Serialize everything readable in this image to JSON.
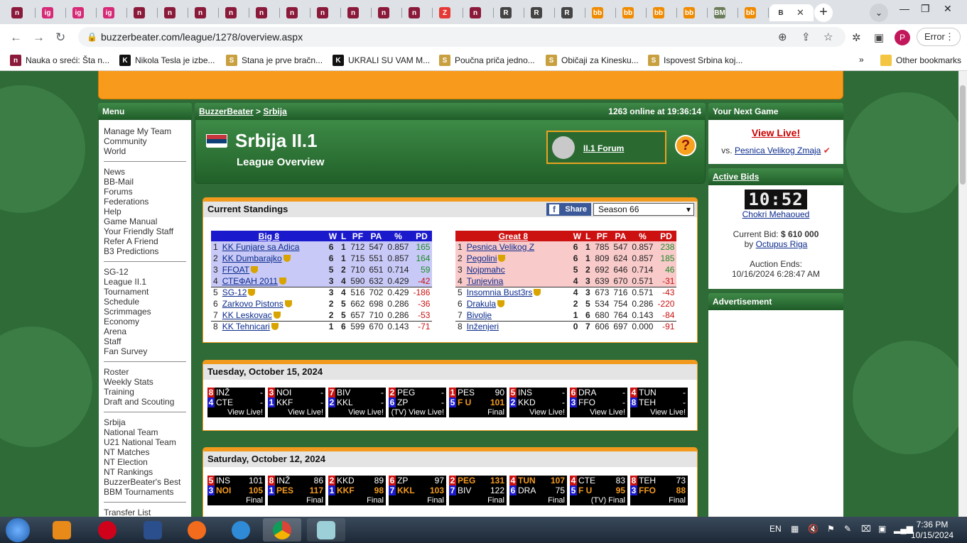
{
  "browser": {
    "url": "buzzerbeater.com/league/1278/overview.aspx",
    "active_tab_label": "B",
    "error_button": "Error",
    "profile_initial": "P",
    "tabs": [
      {
        "label": "n",
        "color": "#8b1a3a"
      },
      {
        "label": "ig",
        "color": "#d62976"
      },
      {
        "label": "ig",
        "color": "#d62976"
      },
      {
        "label": "ig",
        "color": "#d62976"
      },
      {
        "label": "n",
        "color": "#8b1a3a"
      },
      {
        "label": "n",
        "color": "#8b1a3a"
      },
      {
        "label": "n",
        "color": "#8b1a3a"
      },
      {
        "label": "n",
        "color": "#8b1a3a"
      },
      {
        "label": "n",
        "color": "#8b1a3a"
      },
      {
        "label": "n",
        "color": "#8b1a3a"
      },
      {
        "label": "n",
        "color": "#8b1a3a"
      },
      {
        "label": "n",
        "color": "#8b1a3a"
      },
      {
        "label": "n",
        "color": "#8b1a3a"
      },
      {
        "label": "n",
        "color": "#8b1a3a"
      },
      {
        "label": "Z",
        "color": "#e53935"
      },
      {
        "label": "n",
        "color": "#8b1a3a"
      },
      {
        "label": "R",
        "color": "#444444"
      },
      {
        "label": "R",
        "color": "#444444"
      },
      {
        "label": "R",
        "color": "#444444"
      },
      {
        "label": "bb",
        "color": "#f08a00"
      },
      {
        "label": "bb",
        "color": "#f08a00"
      },
      {
        "label": "bb",
        "color": "#f08a00"
      },
      {
        "label": "bb",
        "color": "#f08a00"
      },
      {
        "label": "BM",
        "color": "#6b7d5a"
      },
      {
        "label": "bb",
        "color": "#f08a00"
      }
    ],
    "bookmarks": [
      {
        "icon": "n",
        "color": "#8b1a3a",
        "label": "Nauka o sreći: Šta n..."
      },
      {
        "icon": "K",
        "color": "#111111",
        "label": "Nikola Tesla je izbe..."
      },
      {
        "icon": "S",
        "color": "#c8a040",
        "label": "Stana je prve bračn..."
      },
      {
        "icon": "K",
        "color": "#111111",
        "label": "UKRALI SU VAM M..."
      },
      {
        "icon": "S",
        "color": "#c8a040",
        "label": "Poučna priča jedno..."
      },
      {
        "icon": "S",
        "color": "#c8a040",
        "label": "Običaji za Kinesku..."
      },
      {
        "icon": "S",
        "color": "#c8a040",
        "label": "Ispovest Srbina koj..."
      }
    ],
    "bookmarks_more": "»",
    "other_bookmarks": "Other bookmarks"
  },
  "menu": {
    "title": "Menu",
    "groups": [
      [
        "Manage My Team",
        "Community",
        "World"
      ],
      [
        "News",
        "BB-Mail",
        "Forums",
        "Federations",
        "Help",
        "Game Manual",
        "Your Friendly Staff",
        "Refer A Friend",
        "B3 Predictions"
      ],
      [
        "SG-12",
        "League II.1",
        "Tournament",
        "Schedule",
        "Scrimmages",
        "Economy",
        "Arena",
        "Staff",
        "Fan Survey"
      ],
      [
        "Roster",
        "Weekly Stats",
        "Training",
        "Draft and Scouting"
      ],
      [
        "Srbija",
        "National Team",
        "U21 National Team",
        "NT Matches",
        "NT Election",
        "NT Rankings",
        "BuzzerBeater's Best",
        "BBM Tournaments"
      ],
      [
        "Transfer List"
      ]
    ]
  },
  "breadcrumb": {
    "home": "BuzzerBeater",
    "sep": ">",
    "country": "Srbija",
    "online": "1263 online at 19:36:14"
  },
  "league": {
    "title": "Srbija II.1",
    "subtitle": "League Overview",
    "forum": "II.1 Forum",
    "help": "?"
  },
  "standings": {
    "title": "Current Standings",
    "share": "Share",
    "share_icon": "f",
    "season": "Season 66",
    "headers": [
      "W",
      "L",
      "PF",
      "PA",
      "%",
      "PD"
    ],
    "conferences": [
      {
        "name": "Big 8",
        "color": "#1a1acc",
        "rows": [
          {
            "rank": "1",
            "team": "KK Funjare sa Adica",
            "trophy": false,
            "w": "6",
            "l": "1",
            "pf": "712",
            "pa": "547",
            "pct": "0.857",
            "pd": "165"
          },
          {
            "rank": "2",
            "team": "KK Dumbarajko",
            "trophy": true,
            "w": "6",
            "l": "1",
            "pf": "715",
            "pa": "551",
            "pct": "0.857",
            "pd": "164"
          },
          {
            "rank": "3",
            "team": "FFOAT",
            "trophy": true,
            "w": "5",
            "l": "2",
            "pf": "710",
            "pa": "651",
            "pct": "0.714",
            "pd": "59"
          },
          {
            "rank": "4",
            "team": "СТЕФАН 2011",
            "trophy": true,
            "w": "3",
            "l": "4",
            "pf": "590",
            "pa": "632",
            "pct": "0.429",
            "pd": "-42"
          },
          {
            "rank": "5",
            "team": "SG-12",
            "trophy": true,
            "w": "3",
            "l": "4",
            "pf": "516",
            "pa": "702",
            "pct": "0.429",
            "pd": "-186"
          },
          {
            "rank": "6",
            "team": "Zarkovo Pistons",
            "trophy": true,
            "w": "2",
            "l": "5",
            "pf": "662",
            "pa": "698",
            "pct": "0.286",
            "pd": "-36"
          },
          {
            "rank": "7",
            "team": "KK Leskovac",
            "trophy": true,
            "w": "2",
            "l": "5",
            "pf": "657",
            "pa": "710",
            "pct": "0.286",
            "pd": "-53"
          },
          {
            "rank": "8",
            "team": "KK Tehnicari",
            "trophy": true,
            "w": "1",
            "l": "6",
            "pf": "599",
            "pa": "670",
            "pct": "0.143",
            "pd": "-71"
          }
        ]
      },
      {
        "name": "Great 8",
        "color": "#cc1111",
        "rows": [
          {
            "rank": "1",
            "team": "Pesnica Velikog Z",
            "trophy": false,
            "w": "6",
            "l": "1",
            "pf": "785",
            "pa": "547",
            "pct": "0.857",
            "pd": "238"
          },
          {
            "rank": "2",
            "team": "Pegolini",
            "trophy": true,
            "w": "6",
            "l": "1",
            "pf": "809",
            "pa": "624",
            "pct": "0.857",
            "pd": "185"
          },
          {
            "rank": "3",
            "team": "Nojpmahc",
            "trophy": false,
            "w": "5",
            "l": "2",
            "pf": "692",
            "pa": "646",
            "pct": "0.714",
            "pd": "46"
          },
          {
            "rank": "4",
            "team": "Tunjevina",
            "trophy": false,
            "w": "4",
            "l": "3",
            "pf": "639",
            "pa": "670",
            "pct": "0.571",
            "pd": "-31"
          },
          {
            "rank": "5",
            "team": "Insomnia Bust3rs",
            "trophy": true,
            "w": "4",
            "l": "3",
            "pf": "673",
            "pa": "716",
            "pct": "0.571",
            "pd": "-43"
          },
          {
            "rank": "6",
            "team": "Drakula",
            "trophy": true,
            "w": "2",
            "l": "5",
            "pf": "534",
            "pa": "754",
            "pct": "0.286",
            "pd": "-220"
          },
          {
            "rank": "7",
            "team": "Bivolje",
            "trophy": false,
            "w": "1",
            "l": "6",
            "pf": "680",
            "pa": "764",
            "pct": "0.143",
            "pd": "-84"
          },
          {
            "rank": "8",
            "team": "Inženjeri",
            "trophy": false,
            "w": "0",
            "l": "7",
            "pf": "606",
            "pa": "697",
            "pct": "0.000",
            "pd": "-91"
          }
        ]
      }
    ]
  },
  "days": [
    {
      "date": "Tuesday, October 15, 2024",
      "games": [
        {
          "a_seed": "8",
          "a": "INŽ",
          "a_s": "-",
          "b_seed": "4",
          "b": "CTE",
          "b_s": "-",
          "status": "View Live!",
          "win": ""
        },
        {
          "a_seed": "3",
          "a": "NOI",
          "a_s": "-",
          "b_seed": "1",
          "b": "KKF",
          "b_s": "-",
          "status": "View Live!",
          "win": ""
        },
        {
          "a_seed": "7",
          "a": "BIV",
          "a_s": "-",
          "b_seed": "2",
          "b": "KKL",
          "b_s": "-",
          "status": "View Live!",
          "win": ""
        },
        {
          "a_seed": "2",
          "a": "PEG",
          "a_s": "-",
          "b_seed": "6",
          "b": "ZP",
          "b_s": "-",
          "status": "(TV) View Live!",
          "win": ""
        },
        {
          "a_seed": "1",
          "a": "PES",
          "a_s": "90",
          "b_seed": "5",
          "b": "F U",
          "b_s": "101",
          "status": "Final",
          "win": "b"
        },
        {
          "a_seed": "5",
          "a": "INS",
          "a_s": "-",
          "b_seed": "2",
          "b": "KKD",
          "b_s": "-",
          "status": "View Live!",
          "win": ""
        },
        {
          "a_seed": "6",
          "a": "DRA",
          "a_s": "-",
          "b_seed": "3",
          "b": "FFO",
          "b_s": "-",
          "status": "View Live!",
          "win": ""
        },
        {
          "a_seed": "4",
          "a": "TUN",
          "a_s": "-",
          "b_seed": "8",
          "b": "TEH",
          "b_s": "-",
          "status": "View Live!",
          "win": ""
        }
      ]
    },
    {
      "date": "Saturday, October 12, 2024",
      "games": [
        {
          "a_seed": "5",
          "a": "INS",
          "a_s": "101",
          "b_seed": "3",
          "b": "NOI",
          "b_s": "105",
          "status": "Final",
          "win": "b"
        },
        {
          "a_seed": "8",
          "a": "INŽ",
          "a_s": "86",
          "b_seed": "1",
          "b": "PES",
          "b_s": "117",
          "status": "Final",
          "win": "b"
        },
        {
          "a_seed": "2",
          "a": "KKD",
          "a_s": "89",
          "b_seed": "1",
          "b": "KKF",
          "b_s": "98",
          "status": "Final",
          "win": "b"
        },
        {
          "a_seed": "6",
          "a": "ZP",
          "a_s": "97",
          "b_seed": "7",
          "b": "KKL",
          "b_s": "103",
          "status": "Final",
          "win": "b"
        },
        {
          "a_seed": "2",
          "a": "PEG",
          "a_s": "131",
          "b_seed": "7",
          "b": "BIV",
          "b_s": "122",
          "status": "Final",
          "win": "a"
        },
        {
          "a_seed": "4",
          "a": "TUN",
          "a_s": "107",
          "b_seed": "6",
          "b": "DRA",
          "b_s": "75",
          "status": "Final",
          "win": "a"
        },
        {
          "a_seed": "4",
          "a": "CTE",
          "a_s": "83",
          "b_seed": "5",
          "b": "F U",
          "b_s": "95",
          "status": "(TV) Final",
          "win": "b"
        },
        {
          "a_seed": "8",
          "a": "TEH",
          "a_s": "73",
          "b_seed": "3",
          "b": "FFO",
          "b_s": "88",
          "status": "Final",
          "win": "b"
        }
      ]
    }
  ],
  "side": {
    "next_game_title": "Your Next Game",
    "view_live": "View Live!",
    "vs_prefix": "vs.",
    "opponent": "Pesnica Velikog Zmaja",
    "check": "✔",
    "bids_title": "Active Bids",
    "clock": "10:52",
    "player": "Chokri Mehaoued",
    "bid_label": "Current Bid:",
    "bid_value": "$ 610 000",
    "by_label": "by",
    "bidder": "Octupus Riga",
    "auction_label": "Auction Ends:",
    "auction_end": "10/16/2024 6:28:47 AM",
    "ad_title": "Advertisement"
  },
  "taskbar": {
    "lang": "EN",
    "time": "7:36 PM",
    "date": "10/15/2024"
  }
}
